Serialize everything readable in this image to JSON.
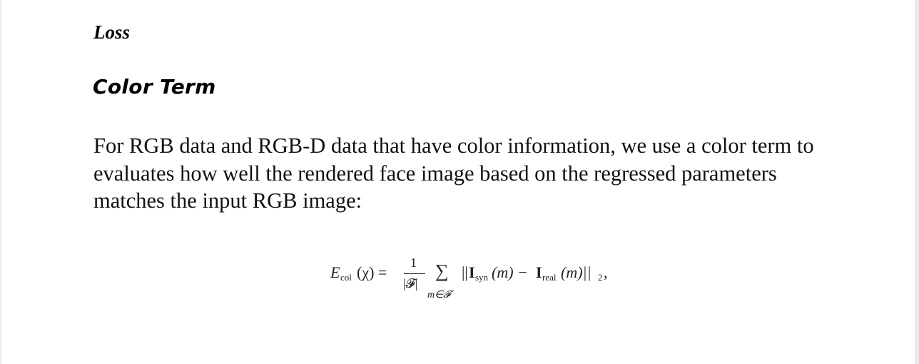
{
  "section": {
    "title": "Loss"
  },
  "subsection": {
    "title": "Color Term"
  },
  "paragraph": {
    "text": "For RGB data and RGB-D data that have color information, we use a color term to evaluates how well the rendered face image based on the regressed parameters matches the input RGB image:"
  },
  "equation": {
    "lhs_symbol": "E",
    "lhs_subscript": "col",
    "lhs_arg": "(χ) =",
    "frac_numerator": "1",
    "frac_denominator": "|𝓕|",
    "sum_symbol": "∑",
    "sum_index": "m∈𝓕",
    "norm_open": "||",
    "term1_symbol": "I",
    "term1_subscript": "syn",
    "term1_arg": "(m) −",
    "term2_symbol": "I",
    "term2_subscript": "real",
    "term2_arg": "(m)||",
    "norm_subscript": "2",
    "trailing": ","
  }
}
